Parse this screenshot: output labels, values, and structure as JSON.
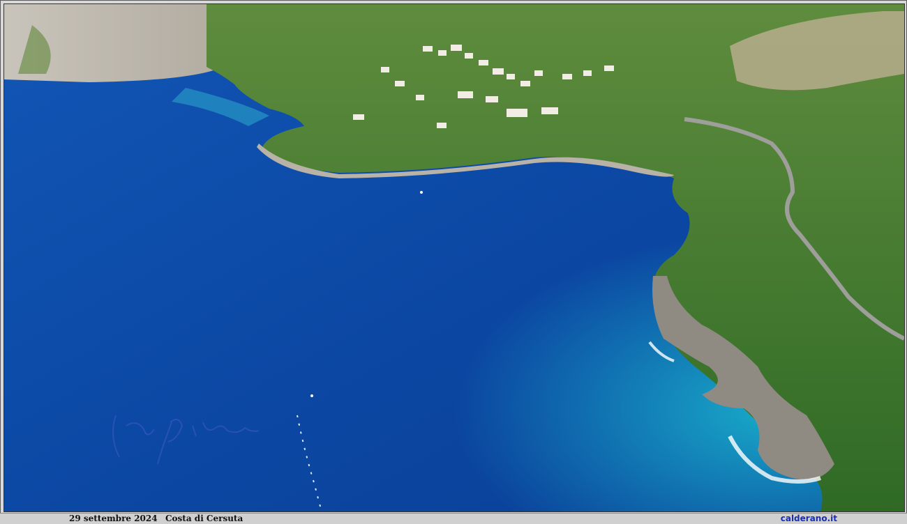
{
  "photo": {
    "subject": "aerial-coastline",
    "colors": {
      "deep_sea": "#0d4aa5",
      "shallow_sea": "#139bc4",
      "vegetation": "#3f7a2c",
      "rock": "#b9b2a6"
    }
  },
  "caption": {
    "date": "29 settembre 2024",
    "place": "Costa di Cersuta",
    "site": "calderano.it"
  }
}
